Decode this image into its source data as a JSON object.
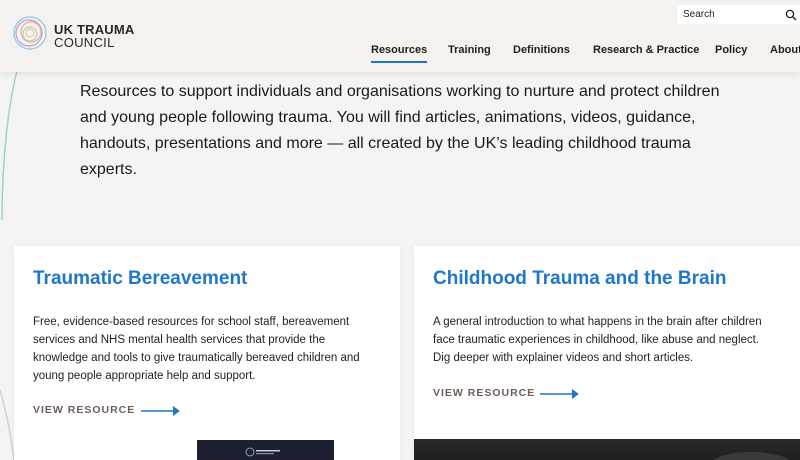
{
  "logo": {
    "line1": "UK TRAUMA",
    "line2": "COUNCIL"
  },
  "search": {
    "placeholder": "Search",
    "icon": "search-icon"
  },
  "nav": {
    "items": [
      {
        "label": "Resources"
      },
      {
        "label": "Training"
      },
      {
        "label": "Definitions"
      },
      {
        "label": "Research & Practice"
      },
      {
        "label": "Policy"
      },
      {
        "label": "About"
      }
    ],
    "active": "Resources"
  },
  "intro": "Resources to support individuals and organisations working to nurture and protect children and young people following trauma. You will find articles, animations, videos, guidance, handouts, presentations and more — all created by the UK’s leading childhood trauma experts.",
  "cards": [
    {
      "title": "Traumatic Bereavement",
      "description": "Free, evidence-based resources for school staff, bereavement services and NHS mental health services that provide the knowledge and tools to give traumatically bereaved children and young people appropriate help and support.",
      "link": "VIEW RESOURCE"
    },
    {
      "title": "Childhood Trauma and the Brain",
      "description": "A general introduction to what happens in the brain after children face traumatic experiences in childhood, like abuse and neglect. Dig deeper with explainer videos and short articles.",
      "link": "VIEW RESOURCE"
    }
  ],
  "colors": {
    "accent": "#1f77c9",
    "link_text": "#6b5f57",
    "header_bg": "#f4f1ef"
  }
}
